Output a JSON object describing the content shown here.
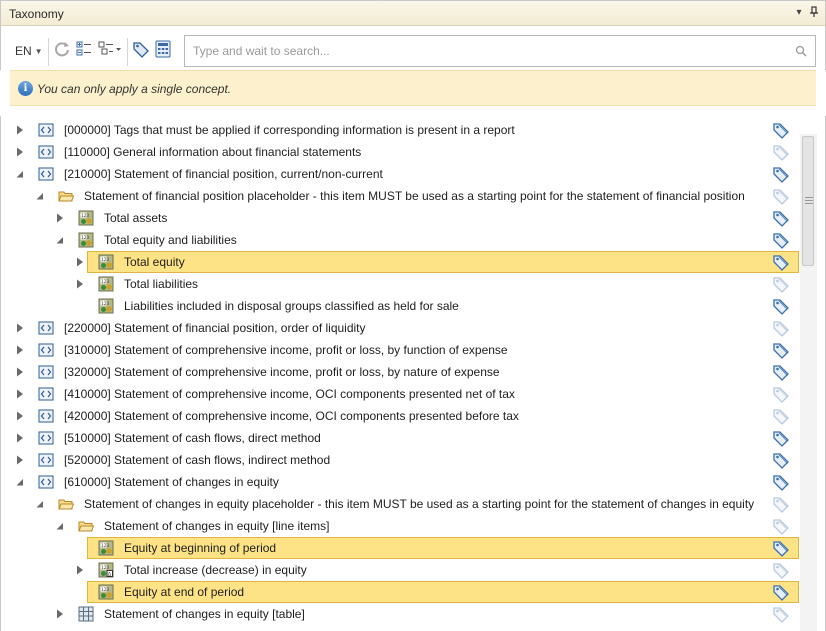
{
  "panel": {
    "title": "Taxonomy",
    "dropdown_glyph": "▾",
    "pin_glyph": "⊥"
  },
  "toolbar": {
    "language": "EN",
    "icons": [
      "refresh-icon",
      "expand-tree-icon",
      "tree-view-options-icon",
      "tag-filter-icon",
      "calculator-icon"
    ],
    "search_placeholder": "Type and wait to search...",
    "search_value": ""
  },
  "info": {
    "message": "You can only apply a single concept."
  },
  "colors": {
    "selected_bg": "#fde386",
    "selected_border": "#e0b53e",
    "info_bg": "#fcf1cc",
    "tag_active": "#3a6fb0",
    "tag_inactive": "#b9c9dd"
  },
  "tree": [
    {
      "level": 0,
      "expander": "collapsed",
      "icon": "section-icon",
      "label": "[000000] Tags that must be applied if corresponding information is present in a report",
      "tag": "active",
      "selected": false
    },
    {
      "level": 0,
      "expander": "collapsed",
      "icon": "section-icon",
      "label": "[110000] General information about financial statements",
      "tag": "inactive",
      "selected": false
    },
    {
      "level": 0,
      "expander": "expanded",
      "icon": "section-icon",
      "label": "[210000] Statement of financial position, current/non-current",
      "tag": "active",
      "selected": false
    },
    {
      "level": 1,
      "expander": "expanded",
      "icon": "folder-open-icon",
      "label": "Statement of financial position placeholder - this item MUST be used as a starting point for the statement of financial position",
      "tag": "inactive",
      "selected": false
    },
    {
      "level": 2,
      "expander": "collapsed",
      "icon": "monetary-concept-icon",
      "label": "Total assets",
      "tag": "active",
      "selected": false
    },
    {
      "level": 2,
      "expander": "expanded",
      "icon": "monetary-concept-icon",
      "label": "Total equity and liabilities",
      "tag": "active",
      "selected": false
    },
    {
      "level": 3,
      "expander": "collapsed",
      "icon": "monetary-concept-icon",
      "label": "Total equity",
      "tag": "active",
      "selected": true
    },
    {
      "level": 3,
      "expander": "collapsed",
      "icon": "monetary-concept-icon",
      "label": "Total liabilities",
      "tag": "inactive",
      "selected": false
    },
    {
      "level": 3,
      "expander": "none",
      "icon": "monetary-concept-icon",
      "label": "Liabilities included in disposal groups classified as held for sale",
      "tag": "active",
      "selected": false
    },
    {
      "level": 0,
      "expander": "collapsed",
      "icon": "section-icon",
      "label": "[220000] Statement of financial position, order of liquidity",
      "tag": "inactive",
      "selected": false
    },
    {
      "level": 0,
      "expander": "collapsed",
      "icon": "section-icon",
      "label": "[310000] Statement of comprehensive income, profit or loss, by function of expense",
      "tag": "active",
      "selected": false
    },
    {
      "level": 0,
      "expander": "collapsed",
      "icon": "section-icon",
      "label": "[320000] Statement of comprehensive income, profit or loss, by nature of expense",
      "tag": "active",
      "selected": false
    },
    {
      "level": 0,
      "expander": "collapsed",
      "icon": "section-icon",
      "label": "[410000] Statement of comprehensive income, OCI components presented net of tax",
      "tag": "inactive",
      "selected": false
    },
    {
      "level": 0,
      "expander": "collapsed",
      "icon": "section-icon",
      "label": "[420000] Statement of comprehensive income, OCI components presented before tax",
      "tag": "inactive",
      "selected": false
    },
    {
      "level": 0,
      "expander": "collapsed",
      "icon": "section-icon",
      "label": "[510000] Statement of cash flows, direct method",
      "tag": "active",
      "selected": false
    },
    {
      "level": 0,
      "expander": "collapsed",
      "icon": "section-icon",
      "label": "[520000] Statement of cash flows, indirect method",
      "tag": "active",
      "selected": false
    },
    {
      "level": 0,
      "expander": "expanded",
      "icon": "section-icon",
      "label": "[610000] Statement of changes in equity",
      "tag": "active",
      "selected": false
    },
    {
      "level": 1,
      "expander": "expanded",
      "icon": "folder-open-icon",
      "label": "Statement of changes in equity placeholder - this item MUST be used as a starting point for the statement of changes in equity",
      "tag": "inactive",
      "selected": false
    },
    {
      "level": 2,
      "expander": "expanded",
      "icon": "folder-open-icon",
      "label": "Statement of changes in equity [line items]",
      "tag": "inactive",
      "selected": false
    },
    {
      "level": 3,
      "expander": "none",
      "icon": "monetary-concept-icon",
      "label": "Equity at beginning of period",
      "tag": "active",
      "selected": true
    },
    {
      "level": 3,
      "expander": "collapsed",
      "icon": "monetary-duration-icon",
      "label": "Total increase (decrease) in equity",
      "tag": "inactive",
      "selected": false
    },
    {
      "level": 3,
      "expander": "none",
      "icon": "monetary-concept-icon",
      "label": "Equity at end of period",
      "tag": "active",
      "selected": true
    },
    {
      "level": 2,
      "expander": "collapsed",
      "icon": "table-icon",
      "label": "Statement of changes in equity [table]",
      "tag": "inactive",
      "selected": false
    }
  ]
}
